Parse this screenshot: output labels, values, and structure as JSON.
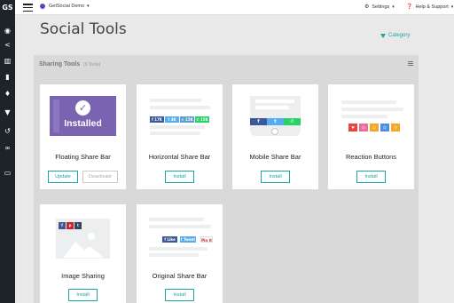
{
  "topbar": {
    "app_name": "GetSocial Demo",
    "settings_label": "Settings",
    "help_label": "Help & Support"
  },
  "rail": {
    "logo": "GS",
    "icons": [
      "dashboard-icon",
      "share-icon",
      "analytics-icon",
      "page-icon",
      "bell-icon",
      "cart-icon",
      "history-icon",
      "link-icon",
      "card-icon"
    ]
  },
  "page": {
    "title": "Social Tools",
    "category_label": "Category"
  },
  "panel": {
    "title": "Sharing Tools",
    "count": "(6 Tools)"
  },
  "tools": [
    {
      "name": "Floating Share Bar",
      "thumb_text": "Installed",
      "primary": "Update",
      "secondary": "Deactivate"
    },
    {
      "name": "Horizontal Share Bar",
      "primary": "Install",
      "counts": [
        "17K",
        "4K",
        "15K",
        "15K"
      ]
    },
    {
      "name": "Mobile Share Bar",
      "primary": "Install"
    },
    {
      "name": "Reaction Buttons",
      "primary": "Install"
    },
    {
      "name": "Image Sharing",
      "primary": "Install"
    },
    {
      "name": "Original Share Bar",
      "primary": "Install",
      "labels": [
        "Like",
        "Tweet",
        "Pin it"
      ]
    }
  ],
  "colors": {
    "accent": "#1aa7a4",
    "installed_thumb": "#7a63b0",
    "facebook": "#3b5998",
    "twitter": "#55acee",
    "whatsapp": "#25d366",
    "pinterest": "#cb2027",
    "tumblr": "#35465c"
  }
}
